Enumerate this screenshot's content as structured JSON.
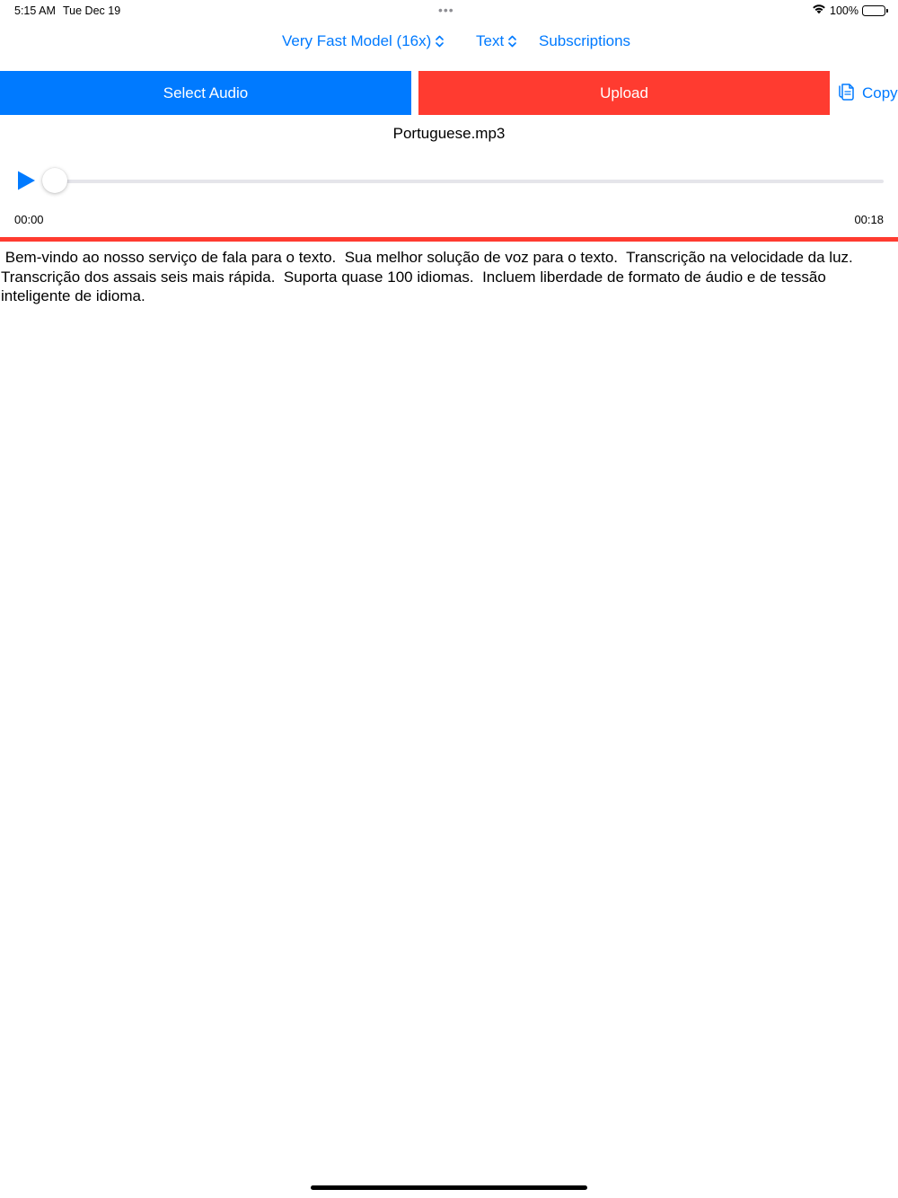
{
  "status_bar": {
    "time": "5:15 AM",
    "date": "Tue Dec 19",
    "battery_percent": "100%",
    "battery_level": 1.0
  },
  "nav": {
    "model_label": "Very Fast Model (16x)",
    "format_label": "Text",
    "subscriptions_label": "Subscriptions"
  },
  "actions": {
    "select_audio_label": "Select Audio",
    "upload_label": "Upload",
    "copy_label": "Copy"
  },
  "player": {
    "file_name": "Portuguese.mp3",
    "current_time": "00:00",
    "duration": "00:18",
    "progress": 0
  },
  "transcript": {
    "text": " Bem-vindo ao nosso serviço de fala para o texto.  Sua melhor solução de voz para o texto.  Transcrição na velocidade da luz.  Transcrição dos assais seis mais rápida.  Suporta quase 100 idiomas.  Incluem liberdade de formato de áudio e de tessão inteligente de idioma."
  },
  "colors": {
    "accent": "#007aff",
    "upload_red": "#ff3b30",
    "divider_red": "#ff3b30",
    "track": "#e5e5ea"
  }
}
